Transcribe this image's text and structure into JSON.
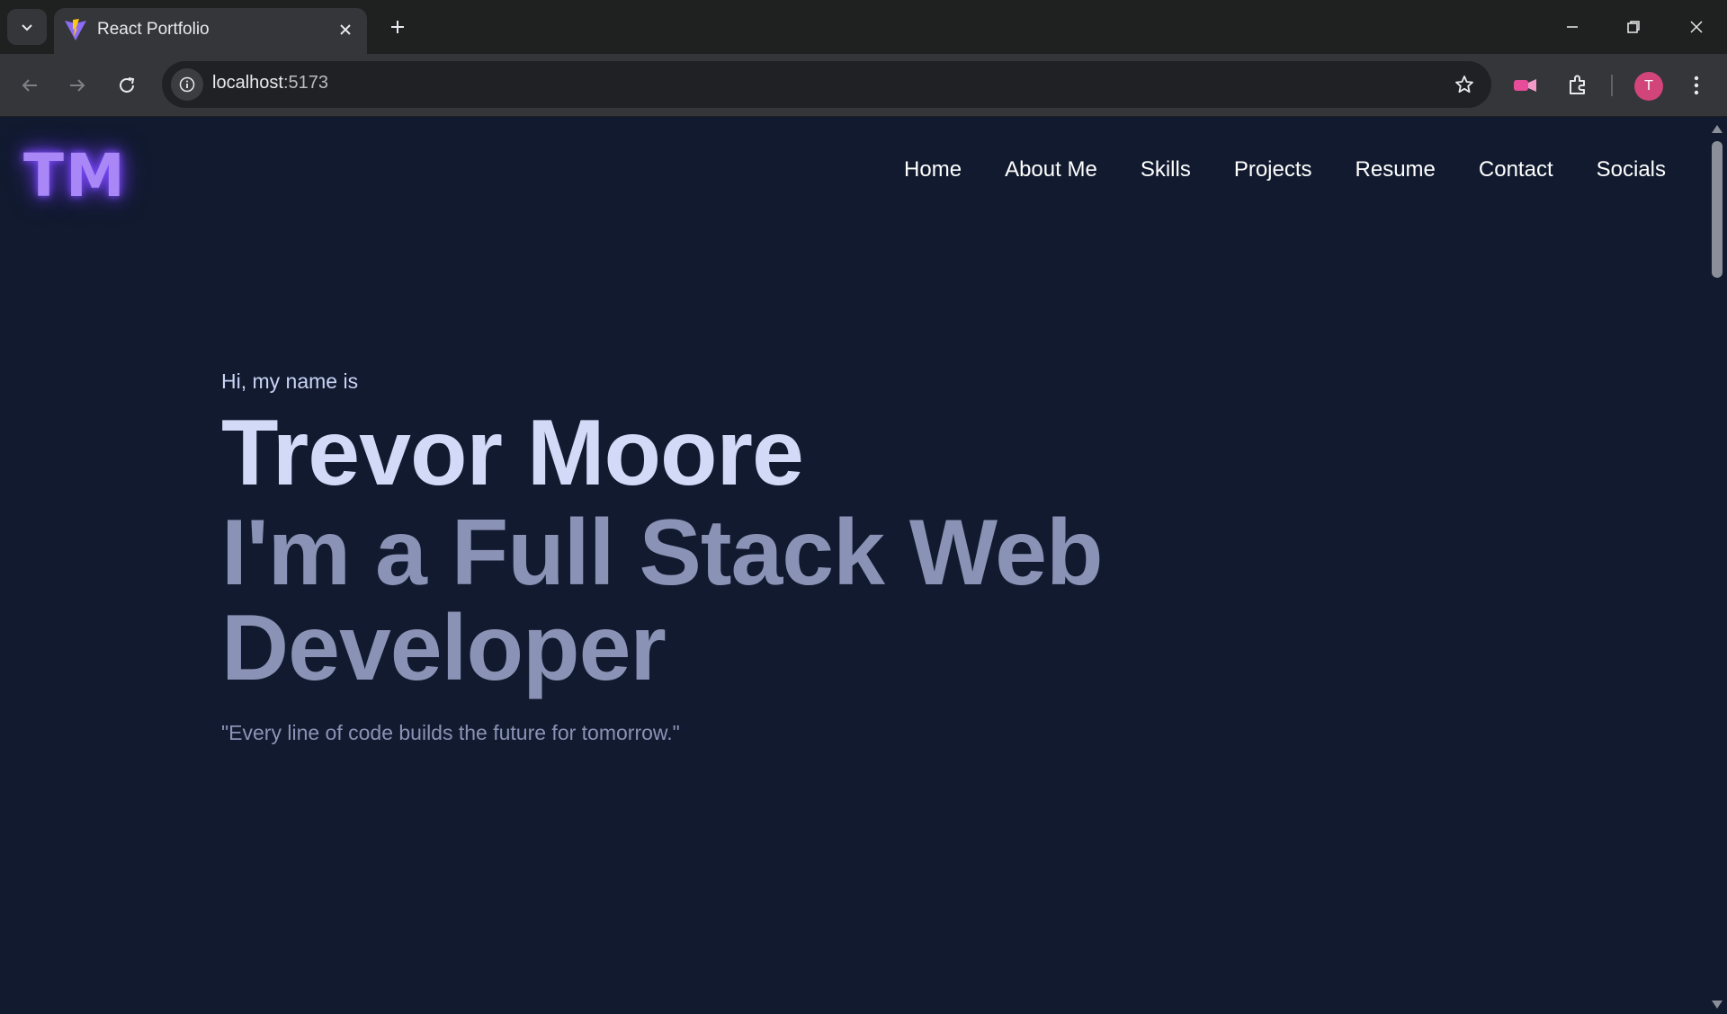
{
  "browser": {
    "tab_title": "React Portfolio",
    "url_host": "localhost",
    "url_port": ":5173",
    "profile_initial": "T"
  },
  "site": {
    "logo": "TM",
    "nav": [
      "Home",
      "About Me",
      "Skills",
      "Projects",
      "Resume",
      "Contact",
      "Socials"
    ]
  },
  "hero": {
    "greeting": "Hi, my name is",
    "name": "Trevor Moore",
    "role": "I'm a Full Stack Web Developer",
    "quote": "\"Every line of code builds the future for tomorrow.\""
  },
  "colors": {
    "page_bg": "#111a2e",
    "logo_glow": "#a987f7",
    "name_text": "#d2daf7",
    "role_text": "#8a93b5",
    "avatar_bg": "#d2457a"
  }
}
